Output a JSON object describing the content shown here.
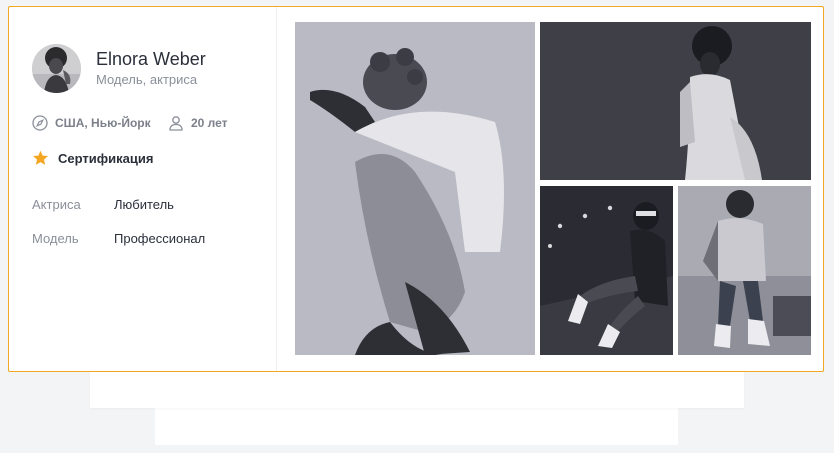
{
  "profile": {
    "name": "Elnora Weber",
    "role": "Модель, актриса",
    "location": "США, Нью-Йорк",
    "age": "20 лет",
    "certification": "Сертификация"
  },
  "skills": [
    {
      "label": "Актриса",
      "value": "Любитель"
    },
    {
      "label": "Модель",
      "value": "Профессионал"
    }
  ],
  "colors": {
    "accent": "#f5a623",
    "star": "#f5a623"
  },
  "icons": [
    "compass-icon",
    "user-icon",
    "star-icon"
  ]
}
